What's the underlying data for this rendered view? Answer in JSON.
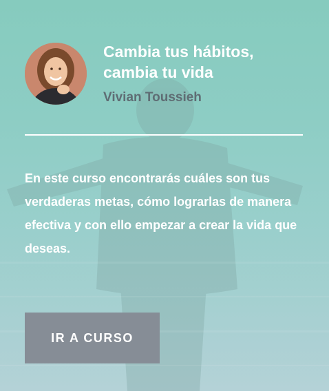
{
  "course": {
    "title": "Cambia tus hábitos, cambia tu vida",
    "author": "Vivian Toussieh",
    "description": "En este curso encontrarás cuáles son tus verdaderas metas, cómo lograrlas de manera efectiva y con ello empezar a crear la vida que deseas.",
    "cta_label": "IR A CURSO"
  },
  "colors": {
    "overlay_teal": "#86cbbe",
    "author_text": "#5f6d74",
    "button_bg": "#868d96",
    "text_light": "#ffffff"
  },
  "images": {
    "background": "person-arms-outstretched-sea-photo",
    "avatar": "author-portrait-photo"
  }
}
